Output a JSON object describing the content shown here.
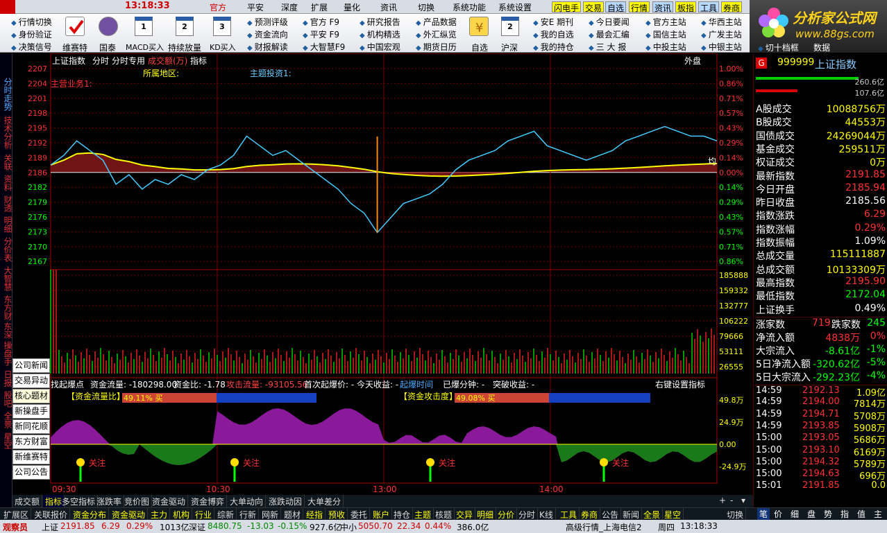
{
  "top": {
    "logo": "",
    "time": "13:18:33",
    "menus": [
      "官方",
      "平安",
      "深度",
      "扩展",
      "量化",
      "资讯",
      "切换",
      "系统功能",
      "系统设置"
    ],
    "quick": [
      "闪电手",
      "交易",
      "自选",
      "行情",
      "资讯",
      "板指",
      "工具",
      "券商"
    ]
  },
  "toolbar": {
    "col1": [
      "行情切换",
      "身份验证",
      "决策信号"
    ],
    "big": [
      "维赛特",
      "国泰",
      "MACD买入",
      "持续放量",
      "KD买入"
    ],
    "col2": [
      "预测评级",
      "资金流向",
      "财报解读"
    ],
    "col3": [
      "官方 F9",
      "平安 F9",
      "大智慧F9"
    ],
    "col4": [
      "研究报告",
      "机构精选",
      "中国宏观"
    ],
    "col5": [
      "产品数据",
      "外汇纵览",
      "期货日历"
    ],
    "big2": [
      "自选",
      "沪深"
    ],
    "col6": [
      "安E 期刊",
      "我的自选",
      "我的持仓"
    ],
    "col7": [
      "今日要闻",
      "最会汇编",
      "三 大 报"
    ],
    "col8": [
      "官方主站",
      "国信主站",
      "中投主站"
    ],
    "col9": [
      "华西主站",
      "广发主站",
      "中银主站"
    ],
    "col10": [
      "切十档框",
      "数据"
    ]
  },
  "brand": {
    "title": "分析家公式网",
    "url": "www.88gs.com"
  },
  "left_tabs": [
    "分时走势",
    "技术分析",
    "关联",
    "资料",
    "财透",
    "明细",
    "分价表",
    "大智慧",
    "东方财",
    "东深",
    "操盘手",
    "日报",
    "股吧",
    "全景",
    "星空"
  ],
  "chart_header": {
    "title": "上证指数",
    "items": [
      "分时",
      "分时专用",
      "成交额(万)",
      "指标"
    ],
    "right": "外盘",
    "label_region": "所属地区:",
    "label_theme": "主题投资1:",
    "label_main": "主营业务1:"
  },
  "price_axis": [
    "2207",
    "2204",
    "2201",
    "2198",
    "2195",
    "2192",
    "2189",
    "2186",
    "2182",
    "2179",
    "2176",
    "2173",
    "2170",
    "2167"
  ],
  "pct_axis": [
    "1.00%",
    "0.86%",
    "0.71%",
    "0.57%",
    "0.43%",
    "0.29%",
    "0.14%",
    "0.00%",
    "0.14%",
    "0.29%",
    "0.43%",
    "0.57%",
    "0.71%",
    "0.86%"
  ],
  "vol_axis": [
    "185888",
    "159332",
    "132777",
    "106222",
    "79666",
    "53111",
    "26555"
  ],
  "ind_axis": [
    "49.8万",
    "24.9万",
    "0.00",
    "-24.9万"
  ],
  "time_axis": [
    "09:30",
    "10:30",
    "13:00",
    "14:00"
  ],
  "avg_label": "均",
  "indicator_bar": {
    "items": [
      "找起爆点",
      "资金流量: -180298.00",
      "资金比: -1.78",
      "攻击流量: -93105.56",
      "首次起爆价: -",
      "今天收益: -",
      "起爆时间",
      "已爆分钟: -",
      "突破收益: -"
    ],
    "right": "右键设置指标"
  },
  "ratio_bar": {
    "left": "【资金流量比】",
    "left_val": "49.11% 买",
    "right": "【资金攻击度】",
    "right_val": "49.08% 买"
  },
  "attention": "关注",
  "news_panel": [
    "公司新闻",
    "交易异动",
    "核心题材",
    "新操盘手",
    "新同花顺",
    "东方财富",
    "新维赛特",
    "公司公告"
  ],
  "rpanel": {
    "badge": "G",
    "code": "999999",
    "name": "上证指数",
    "bar1": "260.6亿",
    "bar2": "107.6亿",
    "rows": [
      {
        "k": "A股成交",
        "v": "10088756万",
        "c": "#ff0"
      },
      {
        "k": "B股成交",
        "v": "44553万",
        "c": "#ff0"
      },
      {
        "k": "国债成交",
        "v": "24269044万",
        "c": "#ff0"
      },
      {
        "k": "基金成交",
        "v": "259511万",
        "c": "#ff0"
      },
      {
        "k": "权证成交",
        "v": "0万",
        "c": "#ff0"
      },
      {
        "k": "最新指数",
        "v": "2191.85",
        "c": "#f33"
      },
      {
        "k": "今日开盘",
        "v": "2185.94",
        "c": "#f33"
      },
      {
        "k": "昨日收盘",
        "v": "2185.56",
        "c": "#fff"
      },
      {
        "k": "指数涨跌",
        "v": "6.29",
        "c": "#f33"
      },
      {
        "k": "指数涨幅",
        "v": "0.29%",
        "c": "#f33"
      },
      {
        "k": "指数振幅",
        "v": "1.09%",
        "c": "#fff"
      },
      {
        "k": "总成交量",
        "v": "115111887",
        "c": "#ff0"
      },
      {
        "k": "总成交额",
        "v": "10133309万",
        "c": "#ff0"
      },
      {
        "k": "最高指数",
        "v": "2195.90",
        "c": "#f33"
      },
      {
        "k": "最低指数",
        "v": "2172.04",
        "c": "#0f0"
      },
      {
        "k": "上证换手",
        "v": "0.49%",
        "c": "#fff"
      }
    ],
    "updown": {
      "up_label": "涨家数",
      "up": "719",
      "down_label": "跌家数",
      "down": "245"
    },
    "flows": [
      {
        "k": "净流入额",
        "v": "4838万",
        "p": "0%",
        "c": "#f33"
      },
      {
        "k": "大宗流入",
        "v": "-8.61亿",
        "p": "-1%",
        "c": "#0f0"
      },
      {
        "k": "5日净流入额",
        "v": "-320.62亿",
        "p": "-5%",
        "c": "#0f0"
      },
      {
        "k": "5日大宗流入",
        "v": "-292.23亿",
        "p": "-4%",
        "c": "#0f0"
      }
    ],
    "ticks": [
      {
        "t": "14:59",
        "p": "2192.13",
        "q": "1.09亿"
      },
      {
        "t": "14:59",
        "p": "2194.00",
        "q": "7814万"
      },
      {
        "t": "14:59",
        "p": "2194.71",
        "q": "5708万"
      },
      {
        "t": "14:59",
        "p": "2193.85",
        "q": "5908万"
      },
      {
        "t": "15:00",
        "p": "2193.05",
        "q": "5686万"
      },
      {
        "t": "15:00",
        "p": "2193.10",
        "q": "6169万"
      },
      {
        "t": "15:00",
        "p": "2194.32",
        "q": "5789万"
      },
      {
        "t": "15:00",
        "p": "2194.63",
        "q": "696万"
      },
      {
        "t": "15:01",
        "p": "2191.85",
        "q": "0.0"
      }
    ]
  },
  "tabs1": [
    "成交额",
    "指标",
    "多空指标",
    "涨跌率",
    "竞价图",
    "资金驱动",
    "资金博弈",
    "大单动向",
    "涨跌动因",
    "大单差分"
  ],
  "tabs2": [
    "扩展区",
    "关联报价",
    "资金分布",
    "资金驱动",
    "主力",
    "机构",
    "行业",
    "综新",
    "行新",
    "网新",
    "题材",
    "经指",
    "预收",
    "委托",
    "账户",
    "持仓",
    "主题",
    "核题",
    "交异",
    "明细",
    "分价",
    "分时",
    "K线",
    "工具",
    "券商",
    "公告",
    "新闻",
    "全景",
    "星空"
  ],
  "tabs2_right": "切换",
  "rtabs": [
    "笔",
    "价",
    "细",
    "盘",
    "势",
    "指",
    "值",
    "主"
  ],
  "status": {
    "user": "观察员",
    "sh_label": "上证",
    "sh_val": "2191.85",
    "sh_chg": "6.29",
    "sh_pct": "0.29%",
    "sh_amt": "1013亿",
    "sz_label": "深证",
    "sz_val": "8480.75",
    "sz_chg": "-13.03",
    "sz_pct": "-0.15%",
    "sz_amt": "927.6亿",
    "zx_label": "中小",
    "zx_val": "5050.70",
    "zx_chg": "22.34",
    "zx_pct": "0.44%",
    "zx_amt": "386.0亿",
    "server": "高级行情_上海电信2",
    "weekday": "周四",
    "time": "13:18:33"
  }
}
